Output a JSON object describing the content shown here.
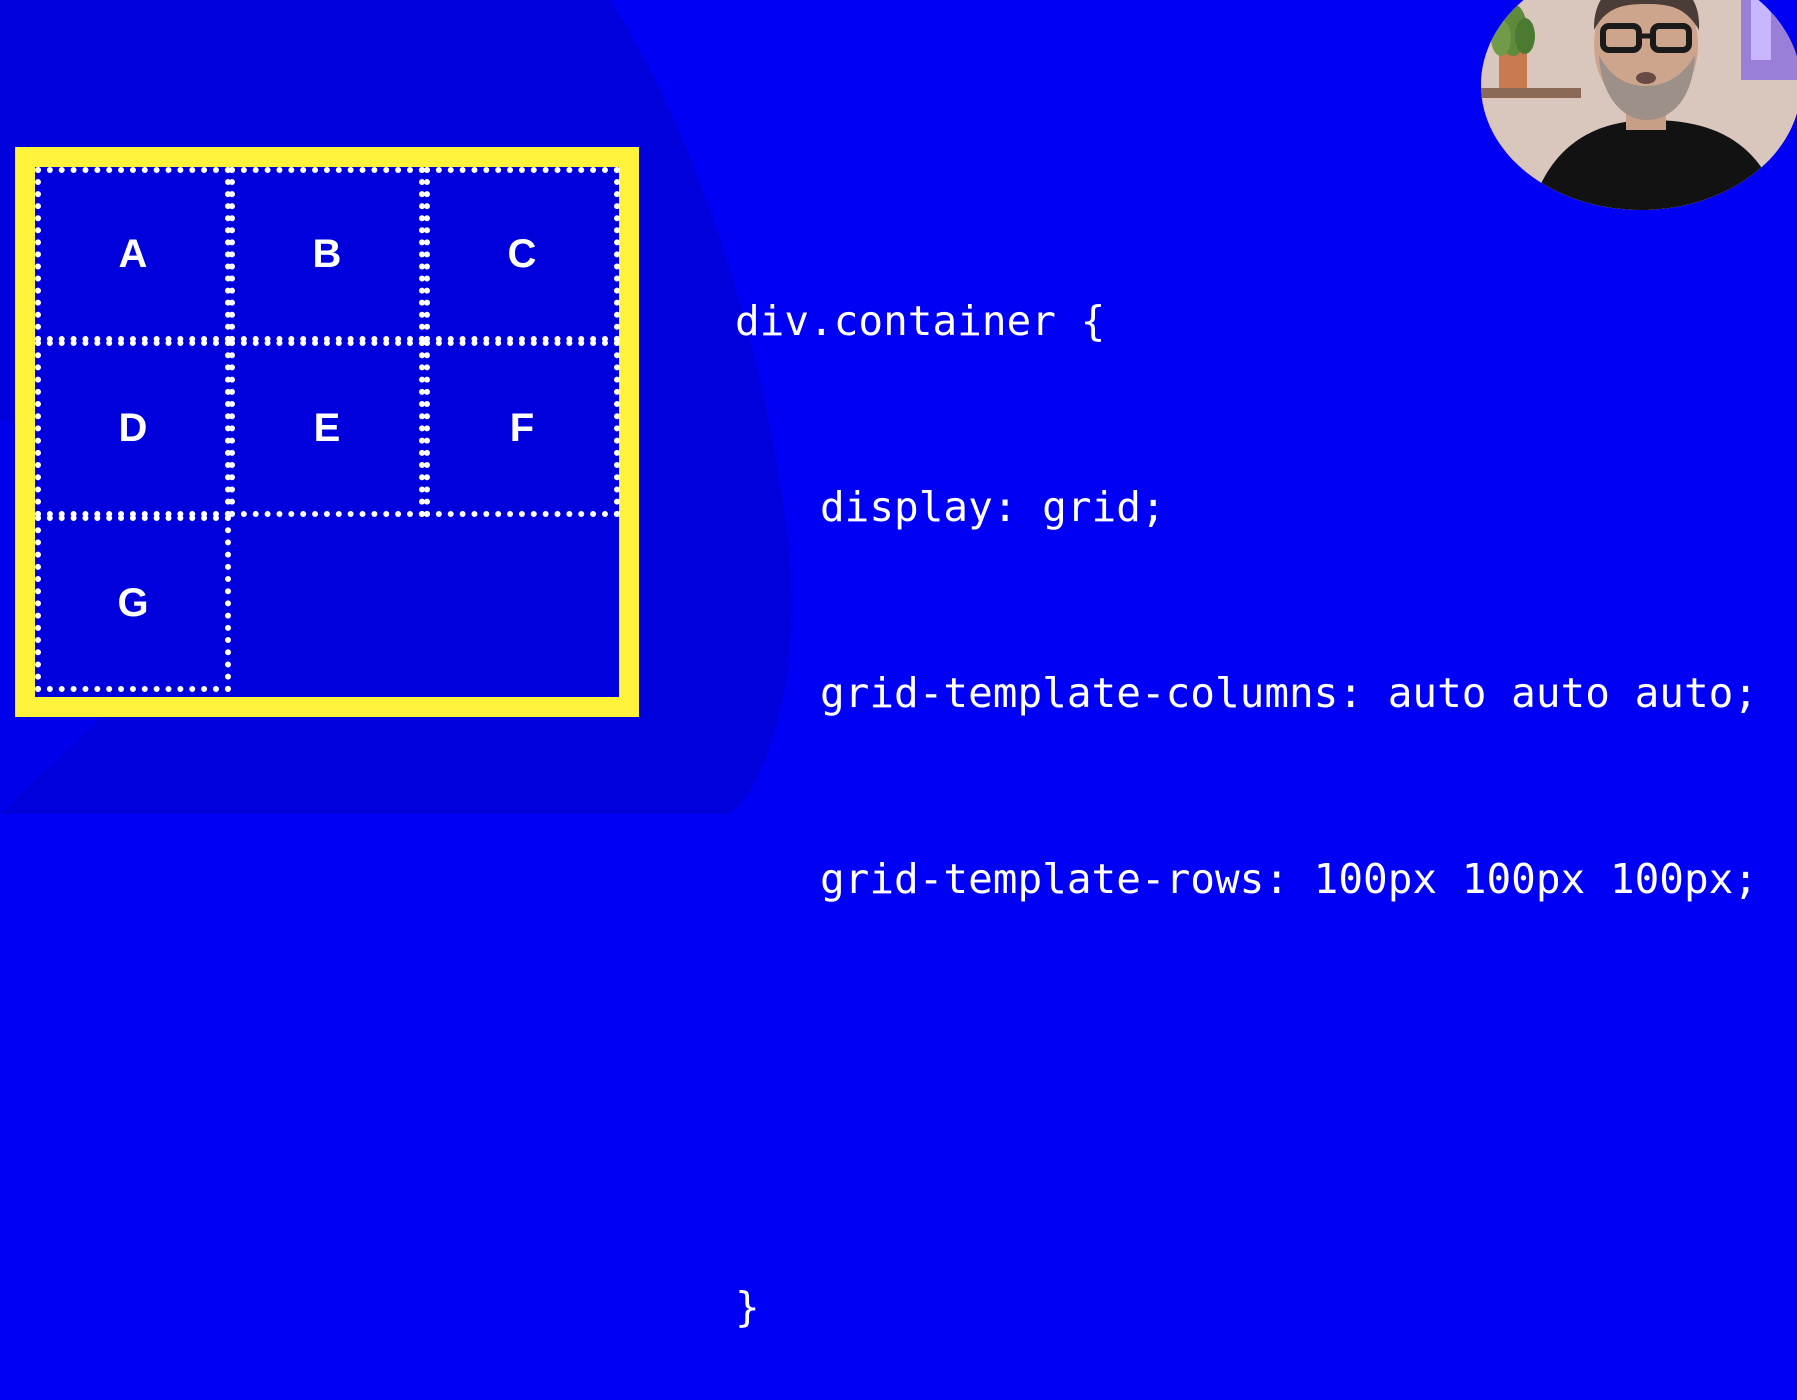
{
  "slide": {
    "background_color": "#0000f4",
    "accent_color": "#fff23b"
  },
  "grid_demo": {
    "cells": [
      "A",
      "B",
      "C",
      "D",
      "E",
      "F",
      "G"
    ]
  },
  "code": {
    "lines": [
      "div.container {",
      "display: grid;",
      "grid-template-columns: auto auto auto;",
      "grid-template-rows: 100px 100px 100px;",
      "}"
    ]
  },
  "presenter": {
    "icon": "presenter-webcam"
  }
}
